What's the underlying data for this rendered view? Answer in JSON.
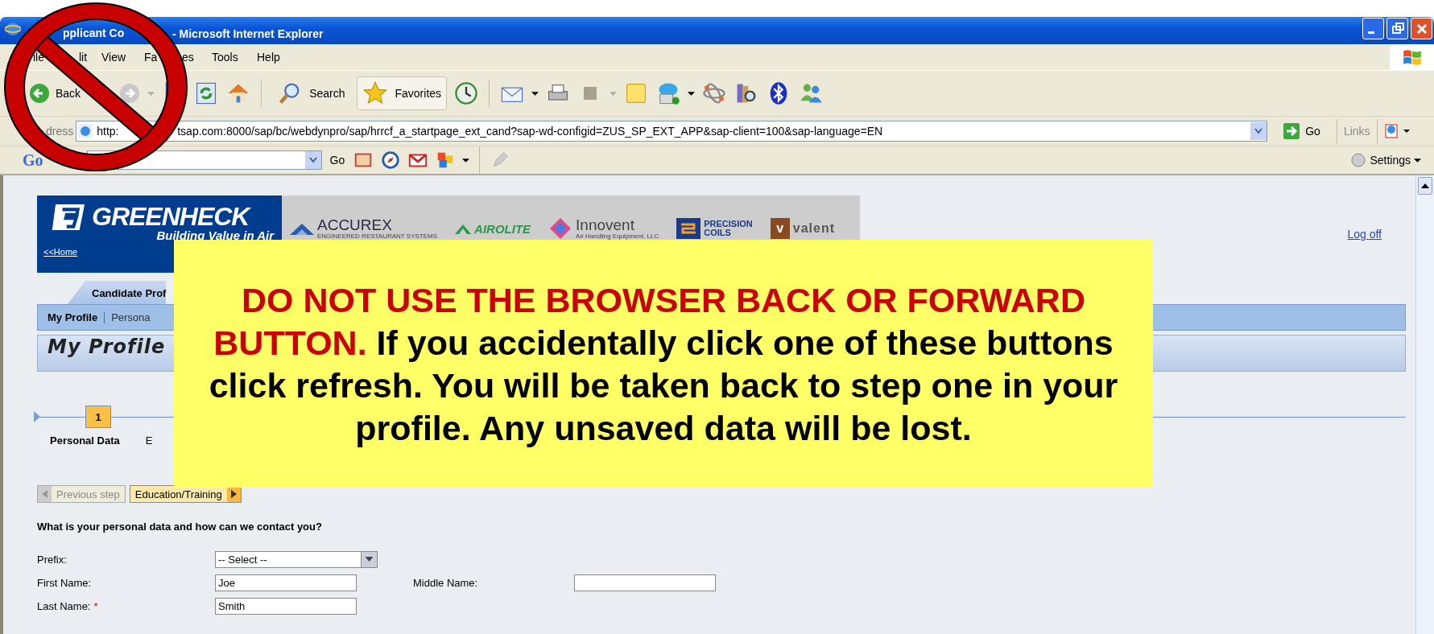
{
  "window": {
    "title_parts": [
      "pplicant Co",
      "- Microsoft Internet Explorer"
    ]
  },
  "menu": [
    {
      "parts": [
        "ile"
      ]
    },
    {
      "parts": [
        "lit"
      ]
    },
    {
      "parts": [
        "View"
      ]
    },
    {
      "parts": [
        "Fa",
        "es"
      ]
    },
    {
      "parts": [
        "Tools"
      ]
    },
    {
      "parts": [
        "Help"
      ]
    }
  ],
  "toolbar": {
    "back": "Back",
    "search": "Search",
    "favorites": "Favorites"
  },
  "address": {
    "label": "dress",
    "url_parts": [
      "http:",
      "tsap.com:8000/sap/bc/webdynpro/sap/hrrcf_a_startpage_ext_cand?sap-wd-configid=ZUS_SP_EXT_APP&sap-client=100&sap-language=EN"
    ],
    "go": "Go",
    "links": "Links"
  },
  "google_bar": {
    "logo": "Go",
    "go": "Go",
    "settings": "Settings"
  },
  "page": {
    "brand": {
      "name": "GREENHECK",
      "tagline": "Building Value in Air",
      "home": "<<Home"
    },
    "partners": [
      {
        "kind": "accurex",
        "lines": [
          "ACCUREX"
        ],
        "sub": "ENGINEERED RESTAURANT SYSTEMS"
      },
      {
        "kind": "airolite",
        "lines": [
          "AIROLITE"
        ]
      },
      {
        "kind": "innovent",
        "lines": [
          "Innovent"
        ],
        "sub": "Air Handling Equipment, LLC"
      },
      {
        "kind": "precision",
        "lines": [
          "PRECISION",
          "COILS"
        ]
      },
      {
        "kind": "valent",
        "lines": [
          "valent"
        ],
        "badge": "v"
      }
    ],
    "logoff": "Log off",
    "tabs": [
      {
        "label": "Candidate Prof",
        "selected": true
      }
    ],
    "subnav": [
      {
        "label": "My Profile",
        "selected": true
      },
      {
        "label": "Persona",
        "selected": false
      }
    ],
    "heading": "My Profile",
    "steps": [
      {
        "number": "1",
        "label": "Personal Data",
        "selected": true
      },
      {
        "label": "E",
        "selected": false
      }
    ],
    "nav_buttons": [
      {
        "kind": "previous",
        "label": "Previous step",
        "disabled": true
      },
      {
        "kind": "next",
        "label": "Education/Training",
        "disabled": false
      }
    ],
    "question": "What is your personal data and how can we contact you?",
    "form_rows": [
      [
        {
          "label": "Prefix:",
          "kind": "select",
          "value": "-- Select --"
        }
      ],
      [
        {
          "label": "First Name:",
          "kind": "text",
          "value": "Joe"
        },
        {
          "label": "Middle Name:",
          "kind": "text"
        }
      ],
      [
        {
          "label": "Last Name:",
          "mark": "*",
          "kind": "text",
          "value": "Smith"
        }
      ]
    ]
  },
  "notice": {
    "warning": "DO NOT USE THE BROWSER BACK OR FORWARD BUTTON.",
    "text": "If you accidentally click one of these buttons click refresh. You will be taken back to step one in your profile. Any unsaved data will be lost."
  }
}
